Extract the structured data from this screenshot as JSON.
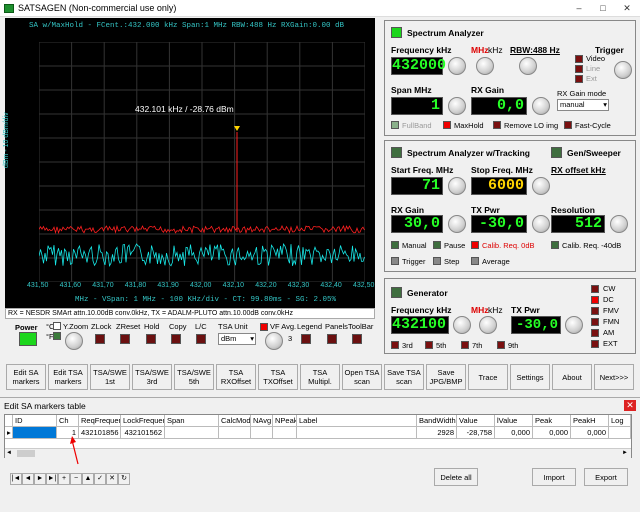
{
  "window": {
    "title": "SATSAGEN (Non-commercial use only)"
  },
  "plot": {
    "header": "SA w/MaxHold - FCent.:432.000 kHz Span:1 MHz RBW:488 Hz RXGain:0.00 dB",
    "ylabel": "dBm - 10 dBm/div",
    "marker_label": "432.101 kHz / -28.76 dBm",
    "footer": "MHz - VSpan: 1 MHz - 100 KHz/div - CT: 99.80ms - SG: 2.05%",
    "x_ticks": [
      "431,50",
      "431,60",
      "431,70",
      "431,80",
      "431,90",
      "432,00",
      "432,10",
      "432,20",
      "432,30",
      "432,40",
      "432,50"
    ]
  },
  "status_line": "RX = NESDR SMArt attn.10.00dB conv.0kHz, TX = ADALM-PLUTO attn.10.00dB conv.0kHz",
  "bottom_controls": {
    "power": "Power",
    "celsius": "°C",
    "fahrenheit": "°F",
    "yzoom": "Y.Zoom",
    "zlock": "ZLock",
    "zreset": "ZReset",
    "hold": "Hold",
    "copy": "Copy",
    "lc": "L/C",
    "tsa_unit": "TSA Unit",
    "tsa_unit_value": "dBm",
    "vf_avg": "VF Avg.",
    "vf_avg_value": "3",
    "legend": "Legend",
    "panels": "Panels",
    "toolbar": "ToolBar"
  },
  "spectrum_analyzer": {
    "title": "Spectrum Analyzer",
    "freq_label": "Frequency kHz",
    "mhz": "MHz",
    "khz": "kHz",
    "rbw": "RBW:488 Hz",
    "trigger": "Trigger",
    "freq_value": "432000",
    "trig_video": "Video",
    "trig_line": "Line",
    "trig_ext": "Ext",
    "span_label": "Span MHz",
    "span_value": "1",
    "rxgain_label": "RX Gain",
    "rxgain_value": "0,0",
    "rxgain_mode_label": "RX Gain mode",
    "rxgain_mode_value": "manual",
    "fullband": "FullBand",
    "maxhold": "MaxHold",
    "remove_lo": "Remove LO img",
    "fastcycle": "Fast-Cycle"
  },
  "tracking": {
    "title": "Spectrum Analyzer w/Tracking",
    "gen_title": "Gen/Sweeper",
    "start_label": "Start Freq. MHz",
    "start_value": "71",
    "stop_label": "Stop Freq. MHz",
    "stop_value": "6000",
    "rxoffset_label": "RX offset kHz",
    "rxgain_label": "RX Gain",
    "rxgain_value": "30,0",
    "txpwr_label": "TX Pwr",
    "txpwr_value": "-30,0",
    "res_label": "Resolution",
    "res_value": "512",
    "manual": "Manual",
    "pause": "Pause",
    "calib": "Calib. Req. 0dB",
    "calib40": "Calib. Req. -40dB",
    "trigger": "Trigger",
    "step": "Step",
    "average": "Average"
  },
  "generator": {
    "title": "Generator",
    "freq_label": "Frequency kHz",
    "mhz": "MHz",
    "khz": "kHz",
    "freq_value": "432100",
    "txpwr_label": "TX Pwr",
    "txpwr_value": "-30,0",
    "h3": "3rd",
    "h5": "5th",
    "h7": "7th",
    "h9": "9th",
    "modes": [
      "CW",
      "DC",
      "FMV",
      "FMN",
      "AM",
      "EXT"
    ]
  },
  "toolbar_buttons": [
    "Edit SA markers",
    "Edit TSA markers",
    "TSA/SWE 1st",
    "TSA/SWE 3rd",
    "TSA/SWE 5th",
    "TSA RXOffset",
    "TSA TXOffset",
    "TSA Multipl.",
    "Open TSA scan",
    "Save TSA scan",
    "Save JPG/BMP",
    "Trace",
    "Settings",
    "About",
    "Next>>>"
  ],
  "markers_table": {
    "title": "Edit SA markers table",
    "columns": [
      "ID",
      "Ch",
      "ReqFrequency",
      "LockFrequency",
      "Span",
      "CalcMode",
      "NAvg",
      "NPeak",
      "Label",
      "BandWidth",
      "Value",
      "lValue",
      "Peak",
      "PeakH",
      "Log"
    ],
    "row": [
      "",
      "1",
      "432101856",
      "432101562",
      "",
      "",
      "",
      "",
      "",
      "2928",
      "-28,758",
      "0,000",
      "0,000",
      "0,000",
      ""
    ],
    "nav": [
      "|◄",
      "◄",
      "►",
      "►|",
      "+",
      "−",
      "▲",
      "✓",
      "✕",
      "↻"
    ],
    "delete_all": "Delete all",
    "import": "Import",
    "export": "Export"
  }
}
